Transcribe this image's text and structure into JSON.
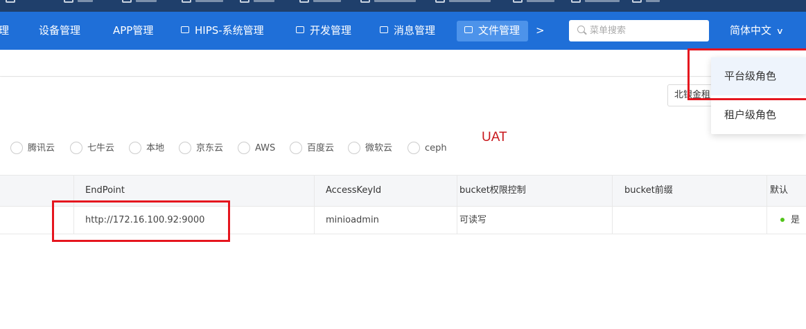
{
  "navbar": {
    "items": [
      {
        "label": "理",
        "icon": ""
      },
      {
        "label": "设备管理",
        "icon": ""
      },
      {
        "label": "APP管理",
        "icon": ""
      },
      {
        "label": "HIPS-系统管理",
        "icon": "panel-icon"
      },
      {
        "label": "开发管理",
        "icon": "panel-icon"
      },
      {
        "label": "消息管理",
        "icon": "message-icon"
      },
      {
        "label": "文件管理",
        "icon": "file-icon",
        "active": true
      }
    ],
    "more": ">",
    "search_placeholder": "菜单搜索",
    "language": "简体中文",
    "colors": {
      "bar": "#1f6fd8",
      "active": "#4d93ea"
    }
  },
  "filter": {
    "tenant_value": "北银金租"
  },
  "storage": {
    "options": [
      "腾讯云",
      "七牛云",
      "本地",
      "京东云",
      "AWS",
      "百度云",
      "微软云",
      "ceph"
    ],
    "env_label": "UAT"
  },
  "table": {
    "columns": [
      "EndPoint",
      "AccessKeyId",
      "bucket权限控制",
      "bucket前缀",
      "默认"
    ],
    "rows": [
      {
        "endpoint": "http://172.16.100.92:9000",
        "access_key_id": "minioadmin",
        "permission": "可读写",
        "prefix": "",
        "default": "是"
      }
    ]
  },
  "role_dropdown": {
    "items": [
      "平台级角色",
      "租户级角色"
    ]
  },
  "annotation_color": "#e5151e"
}
